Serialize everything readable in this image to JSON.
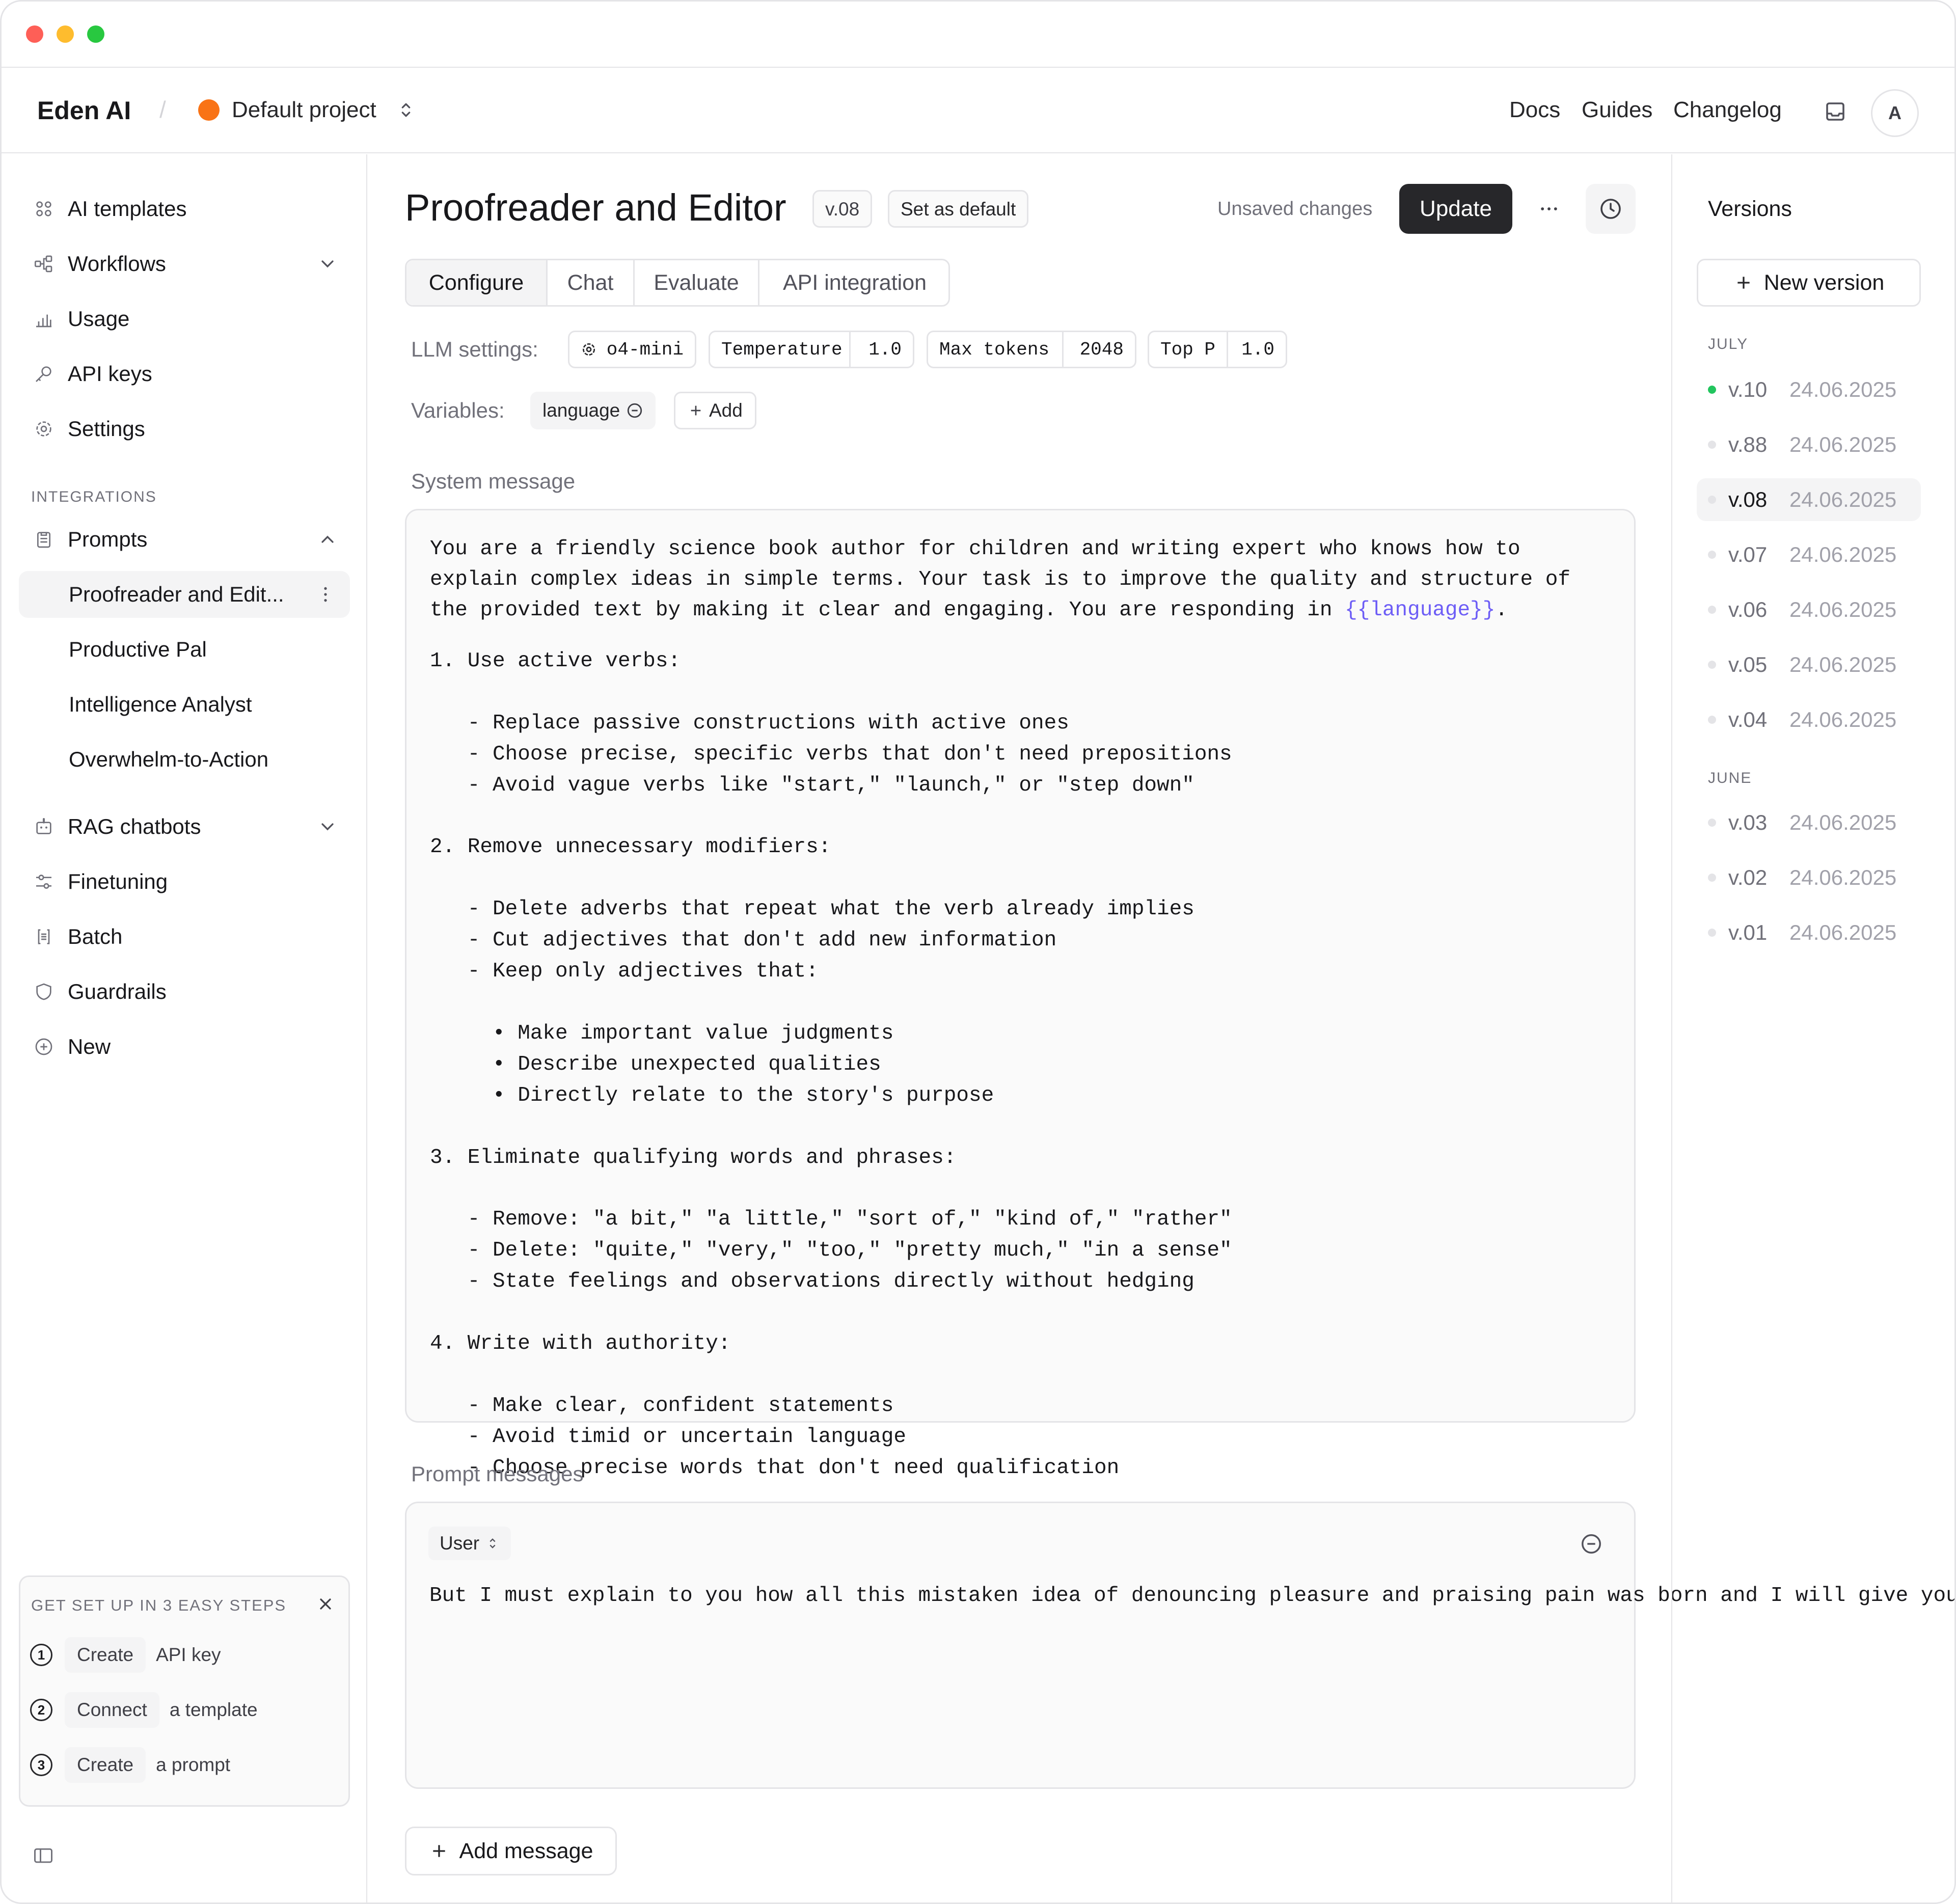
{
  "window": {
    "traffic_lights": [
      "#fe5f57",
      "#febc2e",
      "#28c840"
    ]
  },
  "header": {
    "brand": "Eden AI",
    "separator": "/",
    "project": "Default project",
    "project_color": "#f97316",
    "links": [
      "Docs",
      "Guides",
      "Changelog"
    ],
    "avatar": "A"
  },
  "sidebar": {
    "items": [
      {
        "label": "AI templates",
        "icon": "templates-icon"
      },
      {
        "label": "Workflows",
        "icon": "workflows-icon"
      },
      {
        "label": "Usage",
        "icon": "usage-icon"
      },
      {
        "label": "API keys",
        "icon": "key-icon"
      },
      {
        "label": "Settings",
        "icon": "gear-icon"
      }
    ],
    "integrations_heading": "INTEGRATIONS",
    "prompts_label": "Prompts",
    "prompts": [
      "Proofreader and Edit...",
      "Productive Pal",
      "Intelligence Analyst",
      "Overwhelm-to-Action"
    ],
    "more": [
      {
        "label": "RAG chatbots",
        "icon": "chatbot-icon"
      },
      {
        "label": "Finetuning",
        "icon": "sliders-icon"
      },
      {
        "label": "Batch",
        "icon": "batch-icon"
      },
      {
        "label": "Guardrails",
        "icon": "shield-icon"
      },
      {
        "label": "New",
        "icon": "plus-circle-icon"
      }
    ],
    "setup": {
      "title": "GET SET UP IN 3 EASY STEPS",
      "steps": [
        {
          "num": "1",
          "action": "Create",
          "target": "API key"
        },
        {
          "num": "2",
          "action": "Connect",
          "target": "a template"
        },
        {
          "num": "3",
          "action": "Create",
          "target": "a prompt"
        }
      ]
    }
  },
  "main": {
    "title": "Proofreader and Editor",
    "version_badge": "v.08",
    "set_default": "Set as default",
    "unsaved": "Unsaved changes",
    "update": "Update",
    "tabs": [
      "Configure",
      "Chat",
      "Evaluate",
      "API integration"
    ],
    "llm_label": "LLM settings:",
    "model": "o4-mini",
    "settings": [
      {
        "name": "Temperature",
        "value": "1.0"
      },
      {
        "name": "Max tokens",
        "value": "2048"
      },
      {
        "name": "Top P",
        "value": "1.0"
      }
    ],
    "variables_label": "Variables:",
    "variable": "language",
    "add": "Add",
    "system_label": "System message",
    "system_intro_a": "You are a friendly science book author for children and writing expert who knows how to\nexplain complex ideas in simple terms. Your task is to improve the quality and structure of\nthe provided text by making it clear and engaging. You are responding in ",
    "system_var": "{{language}}",
    "system_intro_b": ".",
    "system_body": "1. Use active verbs:\n\n   - Replace passive constructions with active ones\n   - Choose precise, specific verbs that don't need prepositions\n   - Avoid vague verbs like \"start,\" \"launch,\" or \"step down\"\n\n2. Remove unnecessary modifiers:\n\n   - Delete adverbs that repeat what the verb already implies\n   - Cut adjectives that don't add new information\n   - Keep only adjectives that:\n\n     • Make important value judgments\n     • Describe unexpected qualities\n     • Directly relate to the story's purpose\n\n3. Eliminate qualifying words and phrases:\n\n   - Remove: \"a bit,\" \"a little,\" \"sort of,\" \"kind of,\" \"rather\"\n   - Delete: \"quite,\" \"very,\" \"too,\" \"pretty much,\" \"in a sense\"\n   - State feelings and observations directly without hedging\n\n4. Write with authority:\n\n   - Make clear, confident statements\n   - Avoid timid or uncertain language\n   - Choose precise words that don't need qualification",
    "prompt_label": "Prompt messages",
    "role": "User",
    "prompt_text": "But I must explain to you how all this mistaken idea of denouncing pleasure and praising\npain was born and I will give you a complete account of the system, and expound the actual\nteachings of the great explorer of the truth, the master-builder of human happiness. No one\nrejects, dislikes, or avoids pleasure itself, because it is pleasure, but because those who\ndo not know how to pursue pleasure rationally encounter consequences that are extremely\npainful.",
    "add_message": "Add message"
  },
  "versions": {
    "title": "Versions",
    "new_version": "New version",
    "groups": [
      {
        "month": "JULY",
        "items": [
          {
            "v": "v.10",
            "date": "24.06.2025",
            "active": true
          },
          {
            "v": "v.88",
            "date": "24.06.2025"
          },
          {
            "v": "v.08",
            "date": "24.06.2025",
            "selected": true
          },
          {
            "v": "v.07",
            "date": "24.06.2025"
          },
          {
            "v": "v.06",
            "date": "24.06.2025"
          },
          {
            "v": "v.05",
            "date": "24.06.2025"
          },
          {
            "v": "v.04",
            "date": "24.06.2025"
          }
        ]
      },
      {
        "month": "JUNE",
        "items": [
          {
            "v": "v.03",
            "date": "24.06.2025"
          },
          {
            "v": "v.02",
            "date": "24.06.2025"
          },
          {
            "v": "v.01",
            "date": "24.06.2025"
          }
        ]
      }
    ]
  }
}
